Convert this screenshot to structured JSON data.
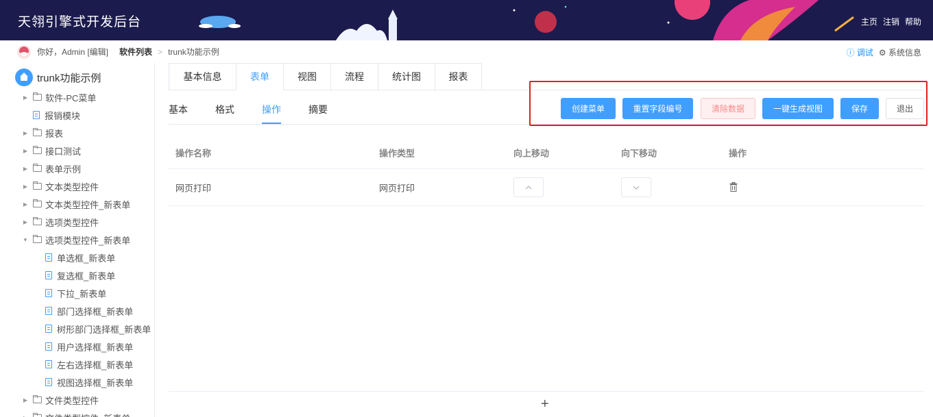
{
  "header": {
    "title": "天翎引擎式开发后台",
    "links": [
      "主页",
      "注销",
      "帮助"
    ]
  },
  "breadcrumb": {
    "greeting": "你好，Admin [编辑]",
    "section": "软件列表",
    "separator": ">",
    "current": "trunk功能示例",
    "right": {
      "debug": "ⓘ 调试",
      "sysinfo": "⚙ 系统信息"
    }
  },
  "sidebar": {
    "root": "trunk功能示例",
    "items": [
      {
        "label": "软件-PC菜单",
        "type": "folder",
        "caret": "▶"
      },
      {
        "label": "报销模块",
        "type": "file",
        "caret": ""
      },
      {
        "label": "报表",
        "type": "folder",
        "caret": "▶"
      },
      {
        "label": "接口测试",
        "type": "folder",
        "caret": "▶"
      },
      {
        "label": "表单示例",
        "type": "folder",
        "caret": "▶"
      },
      {
        "label": "文本类型控件",
        "type": "folder",
        "caret": "▶"
      },
      {
        "label": "文本类型控件_新表单",
        "type": "folder",
        "caret": "▶"
      },
      {
        "label": "选项类型控件",
        "type": "folder",
        "caret": "▶"
      },
      {
        "label": "选项类型控件_新表单",
        "type": "folder",
        "caret": "▼"
      },
      {
        "label": "单选框_新表单",
        "type": "file",
        "caret": ""
      },
      {
        "label": "复选框_新表单",
        "type": "file",
        "caret": ""
      },
      {
        "label": "下拉_新表单",
        "type": "file",
        "caret": ""
      },
      {
        "label": "部门选择框_新表单",
        "type": "file",
        "caret": ""
      },
      {
        "label": "树形部门选择框_新表单",
        "type": "file",
        "caret": ""
      },
      {
        "label": "用户选择框_新表单",
        "type": "file",
        "caret": ""
      },
      {
        "label": "左右选择框_新表单",
        "type": "file",
        "caret": ""
      },
      {
        "label": "视图选择框_新表单",
        "type": "file",
        "caret": ""
      },
      {
        "label": "文件类型控件",
        "type": "folder",
        "caret": "▶"
      },
      {
        "label": "文件类型控件_新表单",
        "type": "folder",
        "caret": "▶"
      }
    ]
  },
  "tabs": [
    "基本信息",
    "表单",
    "视图",
    "流程",
    "统计图",
    "报表"
  ],
  "active_tab": "表单",
  "subtabs": [
    "基本",
    "格式",
    "操作",
    "摘要"
  ],
  "active_subtab": "操作",
  "buttons": {
    "create_menu": "创建菜单",
    "reset_field_no": "重置字段编号",
    "clear_data": "清除数据",
    "generate_view": "一键生成视图",
    "save": "保存",
    "exit": "退出"
  },
  "table": {
    "columns": [
      "操作名称",
      "操作类型",
      "向上移动",
      "向下移动",
      "操作"
    ],
    "rows": [
      {
        "name": "网页打印",
        "type": "网页打印"
      }
    ]
  },
  "add": "+",
  "colors": {
    "primary": "#409eff",
    "header_bg": "#1c1b4d",
    "highlight": "#e02020"
  }
}
